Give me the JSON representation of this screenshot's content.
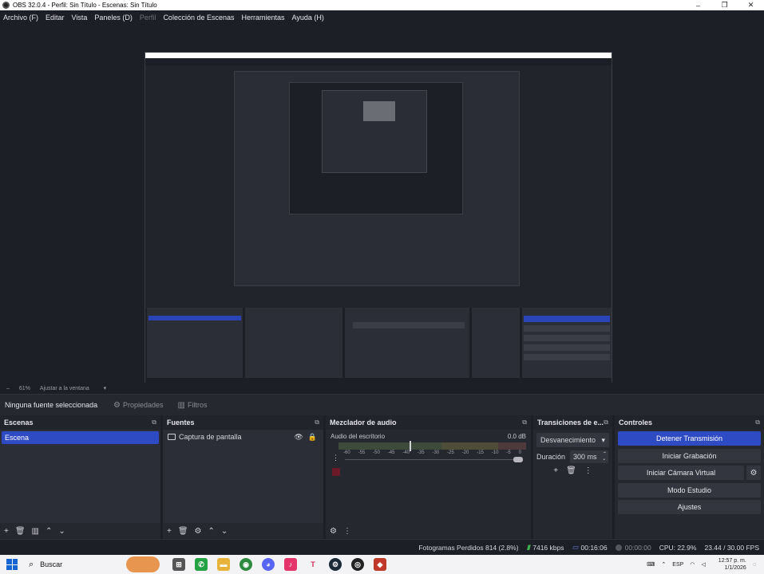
{
  "window": {
    "title": "OBS 32.0.4 - Perfil: Sin Título - Escenas: Sin Título",
    "minimize": "–",
    "maximize": "❐",
    "close": "✕"
  },
  "menu": [
    "Archivo (F)",
    "Editar",
    "Vista",
    "Paneles (D)",
    "Perfil",
    "Colección de Escenas",
    "Herramientas",
    "Ayuda (H)"
  ],
  "zoom": {
    "level": "61%",
    "fit": "Ajustar a la ventana"
  },
  "source_toolbar": {
    "no_source": "Ninguna fuente seleccionada",
    "properties": "Propiedades",
    "filters": "Filtros"
  },
  "scenes": {
    "title": "Escenas",
    "items": [
      "Escena"
    ]
  },
  "sources": {
    "title": "Fuentes",
    "items": [
      "Captura de pantalla"
    ]
  },
  "mixer": {
    "title": "Mezclador de audio",
    "channel": "Audio del escritorio",
    "db": "0.0 dB",
    "ticks": [
      "-60",
      "-55",
      "-50",
      "-45",
      "-40",
      "-35",
      "-30",
      "-25",
      "-20",
      "-15",
      "-10",
      "-5",
      "0"
    ]
  },
  "transitions": {
    "title": "Transiciones de e...",
    "selected": "Desvanecimiento",
    "duration_label": "Duración",
    "duration_value": "300 ms"
  },
  "controls": {
    "title": "Controles",
    "stop_stream": "Detener Transmisión",
    "start_recording": "Iniciar Grabación",
    "start_virtual_cam": "Iniciar Cámara Virtual",
    "studio_mode": "Modo Estudio",
    "settings": "Ajustes"
  },
  "status": {
    "dropped_frames": "Fotogramas Perdidos 814 (2.8%)",
    "bitrate": "7416 kbps",
    "stream_time": "00:16:06",
    "rec_time": "00:00:00",
    "cpu": "CPU: 22.9%",
    "fps": "23.44 / 30.00 FPS"
  },
  "taskbar": {
    "search": "Buscar",
    "lang": "ESP",
    "time": "12:57 p. m.",
    "date": "1/1/2026"
  }
}
